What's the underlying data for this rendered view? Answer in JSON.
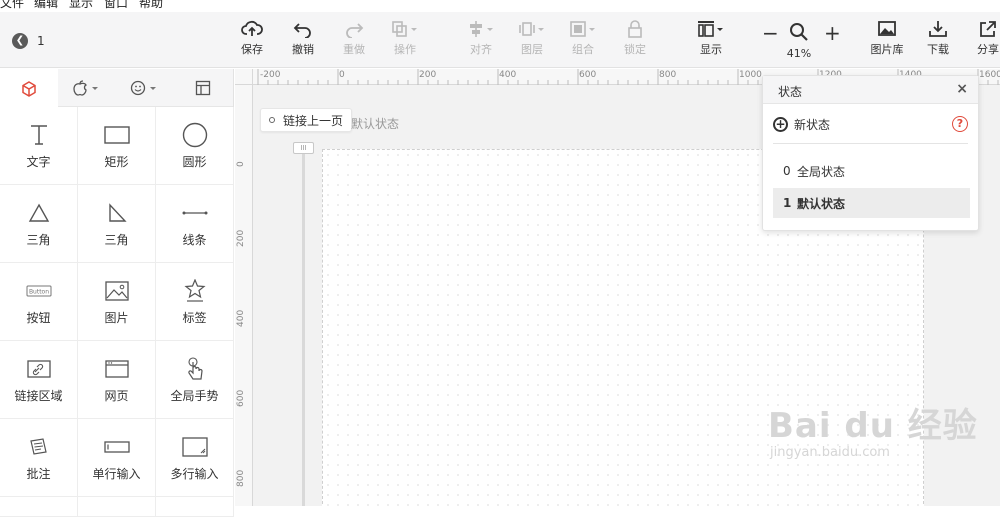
{
  "menu": [
    "文件",
    "编辑",
    "显示",
    "窗口",
    "帮助"
  ],
  "page": {
    "number": "1"
  },
  "toolbar": {
    "save": "保存",
    "undo": "撤销",
    "redo": "重做",
    "operate": "操作",
    "align": "对齐",
    "layer": "图层",
    "group": "组合",
    "lock": "锁定",
    "display": "显示",
    "zoom": "41%",
    "zoom_minus": "−",
    "zoom_plus": "+",
    "image_lib": "图片库",
    "download": "下载",
    "share": "分享"
  },
  "left_tabs": [
    "widgets",
    "apple",
    "emoji",
    "layout"
  ],
  "widgets": [
    {
      "label": "文字",
      "icon": "text-icon"
    },
    {
      "label": "矩形",
      "icon": "rectangle-icon"
    },
    {
      "label": "圆形",
      "icon": "circle-icon"
    },
    {
      "label": "三角",
      "icon": "triangle-icon"
    },
    {
      "label": "三角",
      "icon": "right-triangle-icon"
    },
    {
      "label": "线条",
      "icon": "line-icon"
    },
    {
      "label": "按钮",
      "icon": "button-icon",
      "icon_text": "Button"
    },
    {
      "label": "图片",
      "icon": "image-icon"
    },
    {
      "label": "标签",
      "icon": "star-icon"
    },
    {
      "label": "链接区域",
      "icon": "link-area-icon"
    },
    {
      "label": "网页",
      "icon": "webpage-icon"
    },
    {
      "label": "全局手势",
      "icon": "gesture-icon"
    },
    {
      "label": "批注",
      "icon": "note-icon"
    },
    {
      "label": "单行输入",
      "icon": "single-input-icon"
    },
    {
      "label": "多行输入",
      "icon": "multi-input-icon"
    }
  ],
  "ruler": {
    "h": [
      "-200",
      "0",
      "200",
      "400",
      "600",
      "800",
      "1000",
      "1200",
      "1400",
      "1600"
    ],
    "v": [
      "0",
      "200",
      "400",
      "600",
      "800"
    ]
  },
  "canvas": {
    "link_button": "链接上一页",
    "state_label": "默认状态",
    "handle_text": "III"
  },
  "state_panel": {
    "title": "状态",
    "close": "×",
    "new_state": "新状态",
    "help": "?",
    "items": [
      {
        "index": "0",
        "label": "全局状态",
        "selected": false
      },
      {
        "index": "1",
        "label": "默认状态",
        "selected": true
      }
    ]
  },
  "watermark": {
    "line1": "Bai du 经验",
    "line2": "jingyan.baidu.com"
  }
}
